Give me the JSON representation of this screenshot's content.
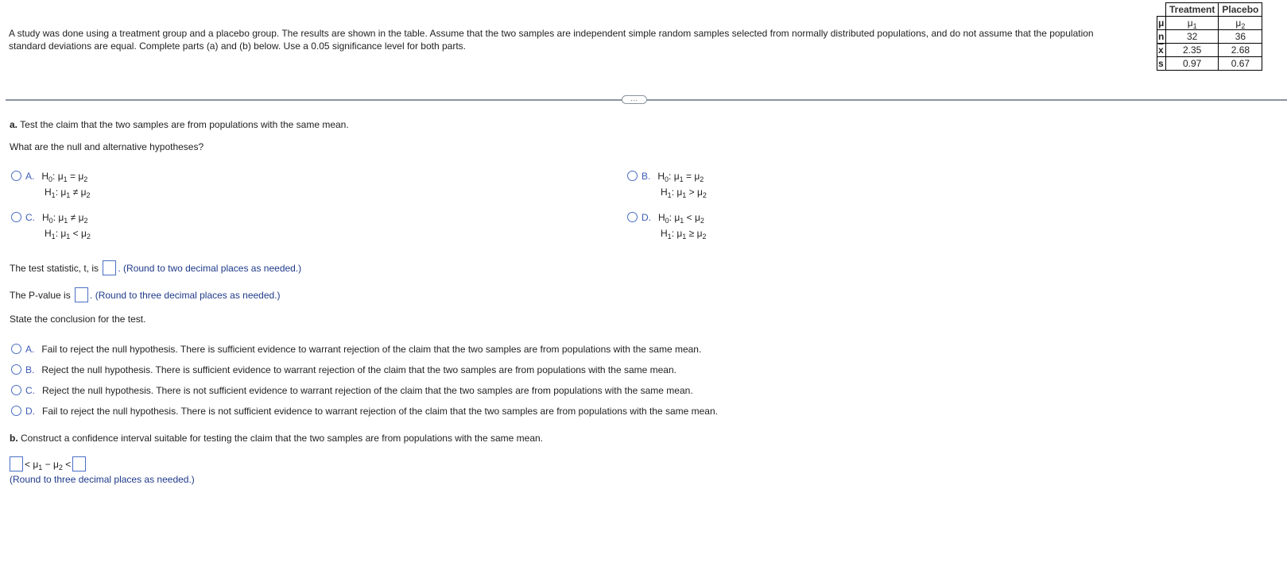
{
  "intro": "A study was done using a treatment group and a placebo group. The results are shown in the table. Assume that the two samples are independent simple random samples selected from normally distributed populations, and do not assume that the population standard deviations are equal. Complete parts (a) and (b) below. Use a 0.05 significance level for both parts.",
  "table": {
    "headers": [
      "Treatment",
      "Placebo"
    ],
    "rows": [
      {
        "label": "μ",
        "treatment": "μ1",
        "placebo": "μ2"
      },
      {
        "label": "n",
        "treatment": "32",
        "placebo": "36"
      },
      {
        "label": "x",
        "treatment": "2.35",
        "placebo": "2.68"
      },
      {
        "label": "s",
        "treatment": "0.97",
        "placebo": "0.67"
      }
    ]
  },
  "more_button": "…",
  "part_a": {
    "label": "a.",
    "text": "Test the claim that the two samples are from populations with the same mean.",
    "question": "What are the null and alternative hypotheses?",
    "hypotheses": [
      {
        "letter": "A.",
        "h0_rel": "=",
        "h1_rel": "≠"
      },
      {
        "letter": "B.",
        "h0_rel": "=",
        "h1_rel": ">"
      },
      {
        "letter": "C.",
        "h0_rel": "≠",
        "h1_rel": "<"
      },
      {
        "letter": "D.",
        "h0_rel": "<",
        "h1_rel": "≥"
      }
    ],
    "test_stat_prefix": "The test statistic, t, is",
    "test_stat_hint": ". (Round to two decimal places as needed.)",
    "test_stat_value": "",
    "pvalue_prefix": "The P-value is",
    "pvalue_hint": ". (Round to three decimal places as needed.)",
    "pvalue_value": "",
    "conclusion_prompt": "State the conclusion for the test.",
    "conclusions": [
      {
        "letter": "A.",
        "text": "Fail to reject the null hypothesis. There is sufficient evidence to warrant rejection of the claim that the two samples are from populations with the same mean."
      },
      {
        "letter": "B.",
        "text": "Reject the null hypothesis. There is sufficient evidence to warrant rejection of the claim that the two samples are from populations with the same mean."
      },
      {
        "letter": "C.",
        "text": "Reject the null hypothesis. There is not sufficient evidence to warrant rejection of the claim that the two samples are from populations with the same mean."
      },
      {
        "letter": "D.",
        "text": "Fail to reject the null hypothesis. There is not sufficient evidence to warrant rejection of the claim that the two samples are from populations with the same mean."
      }
    ]
  },
  "part_b": {
    "label": "b.",
    "text": "Construct a confidence interval suitable for testing the claim that the two samples are from populations with the same mean.",
    "interval_middle": "< μ1 − μ2 <",
    "lower_value": "",
    "upper_value": "",
    "hint": "(Round to three decimal places as needed.)"
  },
  "colors": {
    "accent": "#4a6fc5",
    "hint": "#1f3a8a",
    "divider": "#8a939e"
  }
}
